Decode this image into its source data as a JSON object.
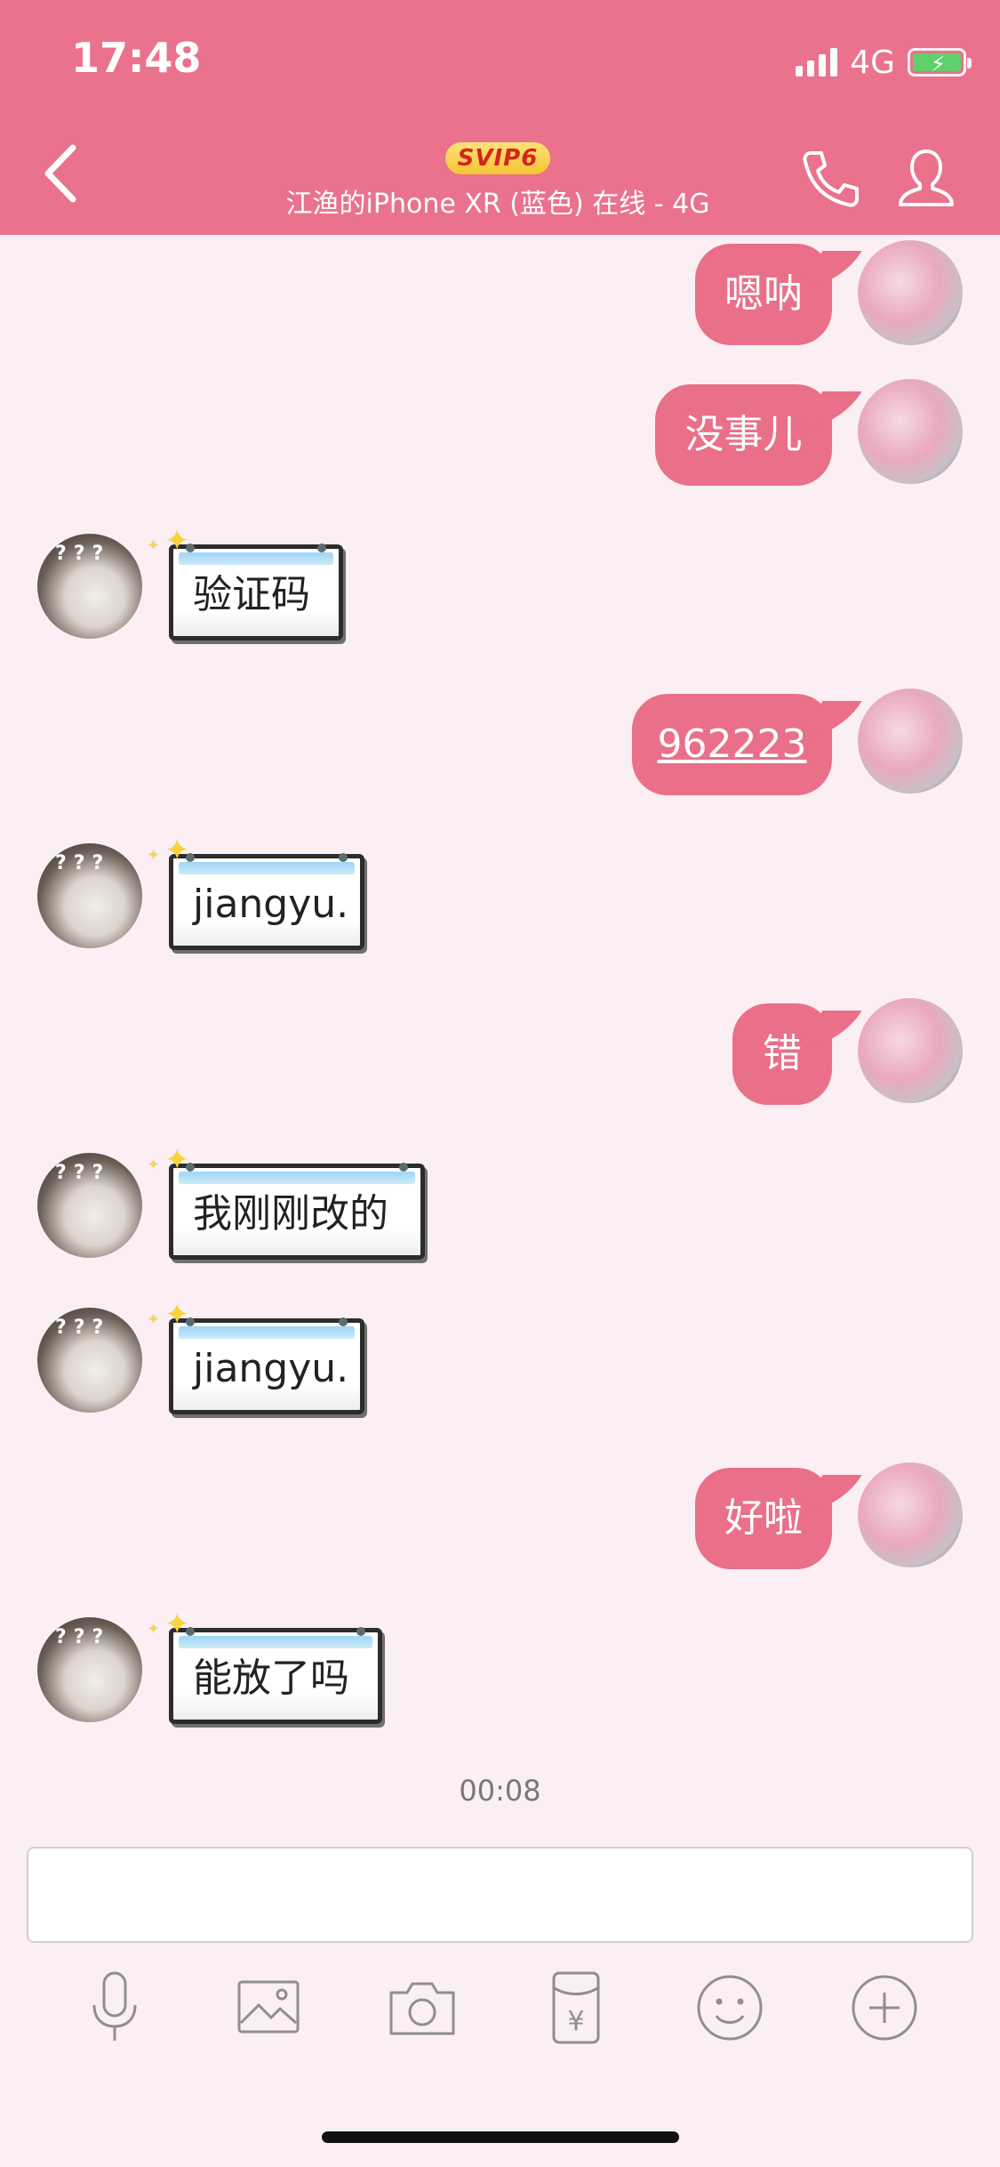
{
  "status_bar": {
    "time": "17:48",
    "network": "4G"
  },
  "header": {
    "svip_badge": "SVIP6",
    "device_status": "江渔的iPhone XR (蓝色) 在线 - 4G"
  },
  "messages": [
    {
      "side": "me",
      "text": "嗯呐"
    },
    {
      "side": "me",
      "text": "没事儿"
    },
    {
      "side": "them",
      "text": "验证码"
    },
    {
      "side": "me",
      "text": "962223",
      "link": true
    },
    {
      "side": "them",
      "text": "jiangyu."
    },
    {
      "side": "me",
      "text": "错"
    },
    {
      "side": "them",
      "text": "我刚刚改的"
    },
    {
      "side": "them",
      "text": "jiangyu."
    },
    {
      "side": "me",
      "text": "好啦"
    },
    {
      "side": "them",
      "text": "能放了吗"
    }
  ],
  "timestamp": "00:08",
  "input": {
    "value": ""
  },
  "toolbar": [
    "mic-icon",
    "image-icon",
    "camera-icon",
    "red-packet-icon",
    "emoji-icon",
    "plus-icon"
  ],
  "colors": {
    "header_bg": "#ea728d",
    "my_bubble": "#ea6f89",
    "chat_bg": "#fbeff3"
  }
}
